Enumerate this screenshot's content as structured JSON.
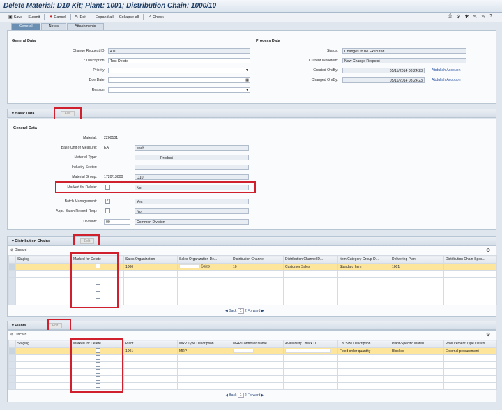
{
  "title": "Delete Material: D10 Kit; Plant: 1001; Distribution Chain: 1000/10",
  "toolbar": {
    "save": "Save",
    "submit": "Submit",
    "cancel": "Cancel",
    "edit": "Edit",
    "expand_all": "Expand all",
    "collapse_all": "Collapse all",
    "check": "Check"
  },
  "tabs": [
    "General",
    "Notes",
    "Attachments"
  ],
  "general": {
    "section_label": "General Data",
    "change_request_id_label": "Change Request ID:",
    "change_request_id": "410",
    "description_label": "* Description:",
    "description": "Test Delete",
    "priority_label": "Priority:",
    "due_date_label": "Due Date:",
    "reason_label": "Reason:"
  },
  "process": {
    "section_label": "Process Data",
    "status_label": "Status:",
    "status": "Changes to Be Executed",
    "workitem_label": "Current Workitem:",
    "workitem": "New Change Request",
    "created_label": "Created On/By:",
    "created": "05/11/2014 08:24:23",
    "created_by": "Abdullah Accouon",
    "changed_label": "Changed On/By:",
    "changed": "05/11/2014 08:24:23",
    "changed_by": "Abdullah Accouon"
  },
  "basic": {
    "header": "Basic Data",
    "edit": "Edit",
    "section_label": "General Data",
    "material_label": "Material:",
    "material": "2200101",
    "uom_label": "Base Unit of Measure:",
    "uom": "EA",
    "uom_text": "each",
    "mtype_label": "Material Type:",
    "mtype_text": "Product",
    "industry_label": "Industry Sector:",
    "mgroup_label": "Material Group:",
    "mgroup": "1720/13000",
    "mgroup_text": "D10",
    "mfd_label": "Marked for Delete:",
    "mfd_text": "No",
    "batch_label": "Batch Management:",
    "batch_text": "Yes",
    "apprbatch_label": "Appr. Batch Record Req.:",
    "apprbatch_text": "No",
    "division_label": "Division:",
    "division": "00",
    "division_text": "Common Division"
  },
  "distribution": {
    "header": "Distribution Chains",
    "edit": "Edit",
    "discard": "Discard",
    "columns": [
      "Staging",
      "Marked for Delete",
      "Sales Organization",
      "Sales Organization De...",
      "Distribution Channel",
      "Distribution Channel D...",
      "Item Category Group D...",
      "Delivering Plant",
      "Distribution Chain-Spec..."
    ],
    "row": [
      "",
      "",
      "1000",
      "Sales",
      "10",
      "Customer Sales",
      "Standard Item",
      "1001",
      ""
    ],
    "pager": {
      "back": "Back",
      "page": "1",
      "of": "2",
      "forward": "Forward"
    }
  },
  "plants": {
    "header": "Plants",
    "edit": "Edit",
    "discard": "Discard",
    "columns": [
      "Staging",
      "Marked for Delete",
      "Plant",
      "MRP Type Description",
      "MRP Controller Name",
      "Availability Check D...",
      "Lot Size Description",
      "Plant-Specific Materi...",
      "Procurement Type Descri..."
    ],
    "row": [
      "",
      "",
      "1001",
      "MRP",
      "",
      "",
      "Fixed order quantity",
      "Blocked",
      "External procurement"
    ],
    "pager": {
      "back": "Back",
      "page": "1",
      "of": "2",
      "forward": "Forward"
    }
  }
}
